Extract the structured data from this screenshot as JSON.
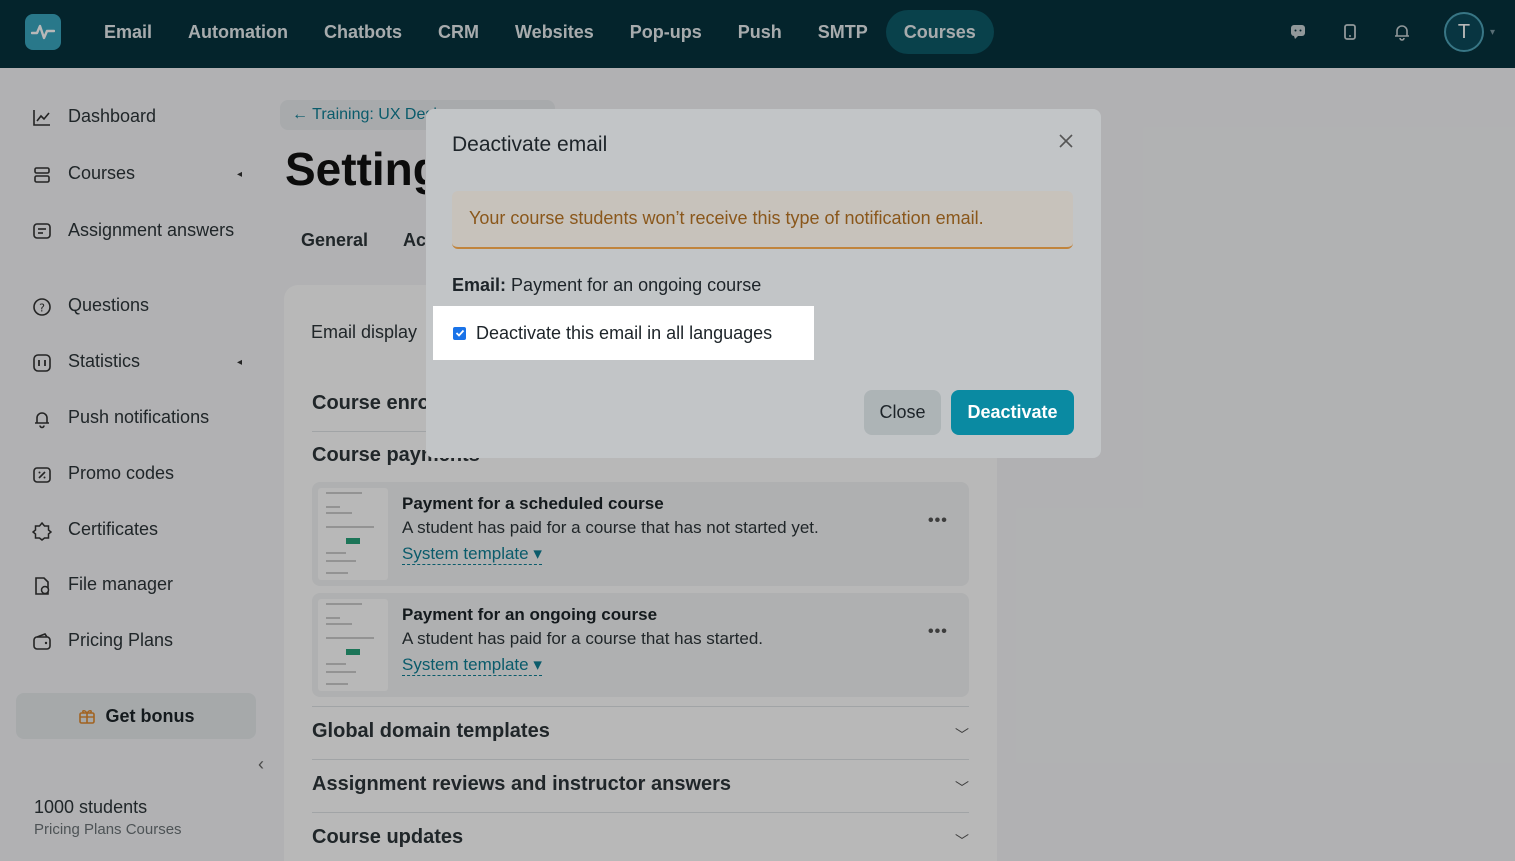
{
  "topnav": {
    "items": [
      "Email",
      "Automation",
      "Chatbots",
      "CRM",
      "Websites",
      "Pop-ups",
      "Push",
      "SMTP",
      "Courses"
    ],
    "active": "Courses",
    "avatar_letter": "T"
  },
  "sidebar": {
    "items": [
      {
        "label": "Dashboard",
        "icon": "chart-line-icon"
      },
      {
        "label": "Courses",
        "icon": "stack-icon",
        "caret": "◂"
      },
      {
        "label": "Assignment answers",
        "icon": "assignment-icon"
      },
      {
        "label": "Questions",
        "icon": "question-icon"
      },
      {
        "label": "Statistics",
        "icon": "statistics-icon",
        "caret": "◂"
      },
      {
        "label": "Push notifications",
        "icon": "bell-icon"
      },
      {
        "label": "Promo codes",
        "icon": "promo-icon"
      },
      {
        "label": "Certificates",
        "icon": "certificate-icon"
      },
      {
        "label": "File manager",
        "icon": "file-icon"
      },
      {
        "label": "Pricing Plans",
        "icon": "wallet-icon"
      }
    ],
    "bonus_label": "Get bonus",
    "collapse_glyph": "‹",
    "plan_students": "1000 students",
    "plan_name": "Pricing Plans Courses"
  },
  "main": {
    "breadcrumb": "← Training: UX Design",
    "title": "Settings",
    "tabs": [
      "General",
      "Ac"
    ],
    "email_display": "Email display",
    "sections": {
      "enrollment": "Course enro",
      "payments": "Course payments",
      "global": "Global domain templates",
      "reviews": "Assignment reviews and instructor answers",
      "updates": "Course updates"
    },
    "templates": [
      {
        "title": "Payment for a scheduled course",
        "desc": "A student has paid for a course that has not started yet.",
        "link": "System template ▾"
      },
      {
        "title": "Payment for an ongoing course",
        "desc": "A student has paid for a course that has started.",
        "link": "System template ▾"
      }
    ],
    "dots": "•••"
  },
  "modal": {
    "title": "Deactivate email",
    "warning": "Your course students won’t receive this type of notification email.",
    "email_label": "Email:",
    "email_value": "Payment for an ongoing course",
    "checkbox_label": "Deactivate this email in all languages",
    "checkbox_checked": true,
    "close_label": "Close",
    "deactivate_label": "Deactivate"
  },
  "colors": {
    "topbar": "#06323d",
    "accent": "#0a8aa2",
    "link": "#0f7f95",
    "warning_text": "#8a571b"
  }
}
